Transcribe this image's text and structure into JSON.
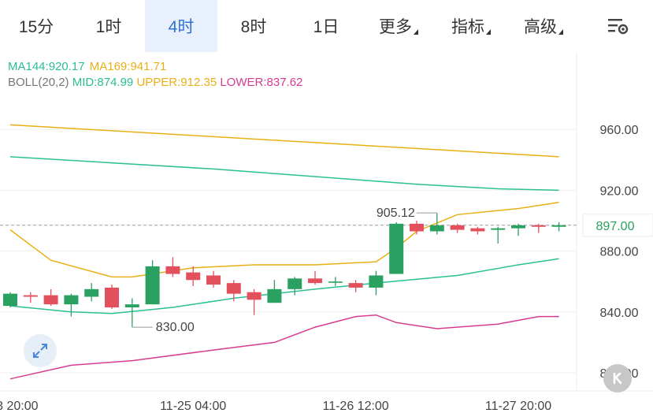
{
  "tabs": [
    {
      "label": "15分",
      "active": false
    },
    {
      "label": "1时",
      "active": false
    },
    {
      "label": "4时",
      "active": true
    },
    {
      "label": "8时",
      "active": false
    },
    {
      "label": "1日",
      "active": false
    }
  ],
  "menus": [
    {
      "label": "更多"
    },
    {
      "label": "指标"
    },
    {
      "label": "高级"
    }
  ],
  "settings_icon": "chart-settings-icon",
  "legend": {
    "ma144": "MA144:920.17",
    "ma169": "MA169:941.71",
    "boll_label": "BOLL(20,2)",
    "mid": "MID:874.99",
    "upper": "UPPER:912.35",
    "lower": "LOWER:837.62"
  },
  "colors": {
    "up": "#e2505d",
    "down": "#2aa161",
    "ma144": "#2bbf95",
    "ma169": "#e8b015",
    "mid": "#2bbf95",
    "upper": "#e8b015",
    "lower": "#d63c8e",
    "active_tab_bg": "#e8f1fb",
    "active_tab_text": "#2f6fd6"
  },
  "chart_data": {
    "type": "candlestick",
    "y_ticks": [
      "960.00",
      "920.00",
      "880.00",
      "840.00",
      "800.00"
    ],
    "y_tick_values": [
      960,
      920,
      880,
      840,
      800
    ],
    "current_price_label": "897.00",
    "current_price": 897,
    "x_labels": [
      "3 20:00",
      "11-25 04:00",
      "11-26 12:00",
      "11-27 20:00"
    ],
    "x_label_index": [
      1,
      9,
      17,
      25
    ],
    "high_label": "905.12",
    "high_value": 905.12,
    "high_index": 21,
    "low_label": "830.00",
    "low_value": 830.0,
    "low_index": 6,
    "candles": [
      {
        "o": 844,
        "c": 852,
        "h": 853,
        "l": 843
      },
      {
        "o": 851,
        "c": 850,
        "h": 853,
        "l": 846
      },
      {
        "o": 851,
        "c": 845,
        "h": 855,
        "l": 844
      },
      {
        "o": 845,
        "c": 851,
        "h": 852,
        "l": 837
      },
      {
        "o": 850,
        "c": 855,
        "h": 859,
        "l": 847
      },
      {
        "o": 856,
        "c": 843,
        "h": 858,
        "l": 842
      },
      {
        "o": 843,
        "c": 845,
        "h": 849,
        "l": 830
      },
      {
        "o": 845,
        "c": 870,
        "h": 874,
        "l": 845
      },
      {
        "o": 870,
        "c": 865,
        "h": 876,
        "l": 863
      },
      {
        "o": 866,
        "c": 861,
        "h": 870,
        "l": 857
      },
      {
        "o": 864,
        "c": 858,
        "h": 867,
        "l": 856
      },
      {
        "o": 859,
        "c": 852,
        "h": 861,
        "l": 847
      },
      {
        "o": 853,
        "c": 848,
        "h": 855,
        "l": 838
      },
      {
        "o": 846,
        "c": 855,
        "h": 861,
        "l": 846
      },
      {
        "o": 855,
        "c": 862,
        "h": 863,
        "l": 851
      },
      {
        "o": 862,
        "c": 859,
        "h": 867,
        "l": 858
      },
      {
        "o": 860,
        "c": 860,
        "h": 863,
        "l": 857
      },
      {
        "o": 859,
        "c": 856,
        "h": 861,
        "l": 853
      },
      {
        "o": 856,
        "c": 864,
        "h": 867,
        "l": 851
      },
      {
        "o": 865,
        "c": 898,
        "h": 899,
        "l": 865
      },
      {
        "o": 898,
        "c": 893,
        "h": 900,
        "l": 891
      },
      {
        "o": 893,
        "c": 897,
        "h": 905.12,
        "l": 891
      },
      {
        "o": 897,
        "c": 894,
        "h": 898,
        "l": 892
      },
      {
        "o": 895,
        "c": 893,
        "h": 896,
        "l": 891
      },
      {
        "o": 894,
        "c": 895,
        "h": 896,
        "l": 885
      },
      {
        "o": 895,
        "c": 897,
        "h": 898,
        "l": 890
      },
      {
        "o": 897,
        "c": 896,
        "h": 898,
        "l": 892
      },
      {
        "o": 896,
        "c": 897,
        "h": 899,
        "l": 893
      }
    ],
    "lines": {
      "ma169": [
        [
          0,
          963
        ],
        [
          27,
          942
        ]
      ],
      "ma144": [
        [
          0,
          942
        ],
        [
          10,
          934
        ],
        [
          20,
          924
        ],
        [
          24,
          921
        ],
        [
          27,
          920
        ]
      ],
      "upper": [
        [
          0,
          894
        ],
        [
          2,
          874
        ],
        [
          5,
          863
        ],
        [
          6,
          863
        ],
        [
          9,
          869
        ],
        [
          12,
          871
        ],
        [
          15,
          871
        ],
        [
          18,
          873
        ],
        [
          19,
          882
        ],
        [
          20,
          893
        ],
        [
          22,
          904
        ],
        [
          25,
          908
        ],
        [
          27,
          912
        ]
      ],
      "mid": [
        [
          0,
          844
        ],
        [
          3,
          840
        ],
        [
          5,
          839
        ],
        [
          8,
          843
        ],
        [
          11,
          849
        ],
        [
          15,
          855
        ],
        [
          18,
          859
        ],
        [
          22,
          864
        ],
        [
          25,
          871
        ],
        [
          27,
          875
        ]
      ],
      "lower": [
        [
          0,
          796
        ],
        [
          3,
          805
        ],
        [
          6,
          808
        ],
        [
          10,
          815
        ],
        [
          13,
          820
        ],
        [
          15,
          830
        ],
        [
          17,
          837
        ],
        [
          18,
          838
        ],
        [
          19,
          833
        ],
        [
          21,
          829
        ],
        [
          24,
          832
        ],
        [
          26,
          837
        ],
        [
          27,
          837
        ]
      ]
    }
  }
}
